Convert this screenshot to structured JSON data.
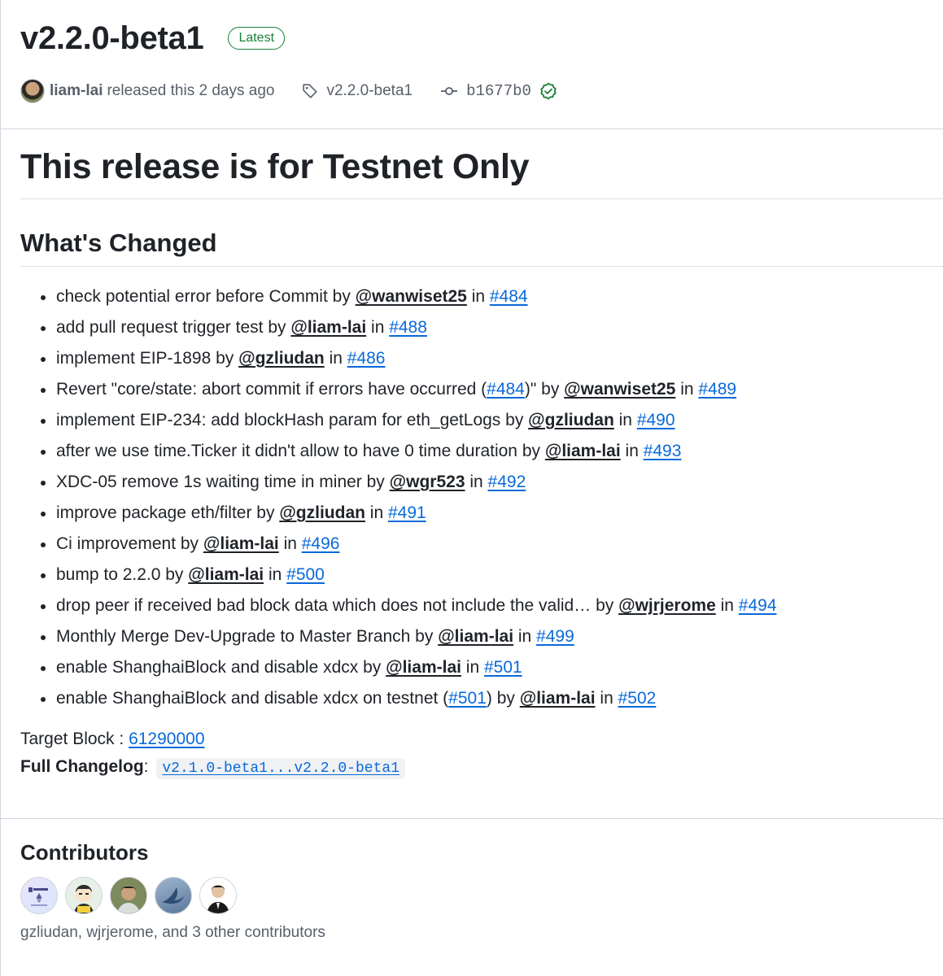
{
  "release": {
    "title": "v2.2.0-beta1",
    "badge": "Latest",
    "author": "liam-lai",
    "released_text": "released this 2 days ago",
    "tag": "v2.2.0-beta1",
    "commit": "b1677b0"
  },
  "body": {
    "heading": "This release is for Testnet Only",
    "subheading": "What's Changed",
    "changes": [
      {
        "text": "check potential error before Commit by ",
        "user": "@wanwiset25",
        "in": " in ",
        "pr": "#484"
      },
      {
        "text": "add pull request trigger test by ",
        "user": "@liam-lai",
        "in": " in ",
        "pr": "#488"
      },
      {
        "text": "implement EIP-1898 by ",
        "user": "@gzliudan",
        "in": " in ",
        "pr": "#486"
      },
      {
        "text_a": "Revert \"core/state: abort commit if errors have occurred (",
        "ref": "#484",
        "text_b": ")\" by ",
        "user": "@wanwiset25",
        "in": " in ",
        "pr": "#489"
      },
      {
        "text": "implement EIP-234: add blockHash param for eth_getLogs by ",
        "user": "@gzliudan",
        "in": " in ",
        "pr": "#490"
      },
      {
        "text": "after we use time.Ticker it didn't allow to have 0 time duration by ",
        "user": "@liam-lai",
        "in": " in ",
        "pr": "#493"
      },
      {
        "text": "XDC-05 remove 1s waiting time in miner by ",
        "user": "@wgr523",
        "in": " in ",
        "pr": "#492"
      },
      {
        "text": "improve package eth/filter by ",
        "user": "@gzliudan",
        "in": " in ",
        "pr": "#491"
      },
      {
        "text": "Ci improvement by ",
        "user": "@liam-lai",
        "in": " in ",
        "pr": "#496"
      },
      {
        "text": "bump to 2.2.0 by ",
        "user": "@liam-lai",
        "in": " in ",
        "pr": "#500"
      },
      {
        "text": "drop peer if received bad block data which does not include the valid… by ",
        "user": "@wjrjerome",
        "in": " in ",
        "pr": "#494"
      },
      {
        "text": "Monthly Merge Dev-Upgrade to Master Branch by ",
        "user": "@liam-lai",
        "in": " in ",
        "pr": "#499"
      },
      {
        "text": "enable ShanghaiBlock and disable xdcx by ",
        "user": "@liam-lai",
        "in": " in ",
        "pr": "#501"
      },
      {
        "text_a": "enable ShanghaiBlock and disable xdcx on testnet (",
        "ref": "#501",
        "text_b": ") by ",
        "user": "@liam-lai",
        "in": " in ",
        "pr": "#502"
      }
    ],
    "target_label": "Target Block : ",
    "target_value": "61290000",
    "changelog_label": "Full Changelog",
    "changelog_colon": ":",
    "changelog_value": "v2.1.0-beta1...v2.2.0-beta1"
  },
  "contributors": {
    "heading": "Contributors",
    "avatars": [
      "solidity-ethereum-avatar",
      "cartoon-avatar",
      "person-avatar",
      "bird-avatar",
      "suit-person-avatar"
    ],
    "summary": "gzliudan, wjrjerome, and 3 other contributors"
  },
  "colors": {
    "link": "#0969da",
    "badge_green": "#1a7f37",
    "text": "#1f2328",
    "muted": "#57606a"
  }
}
